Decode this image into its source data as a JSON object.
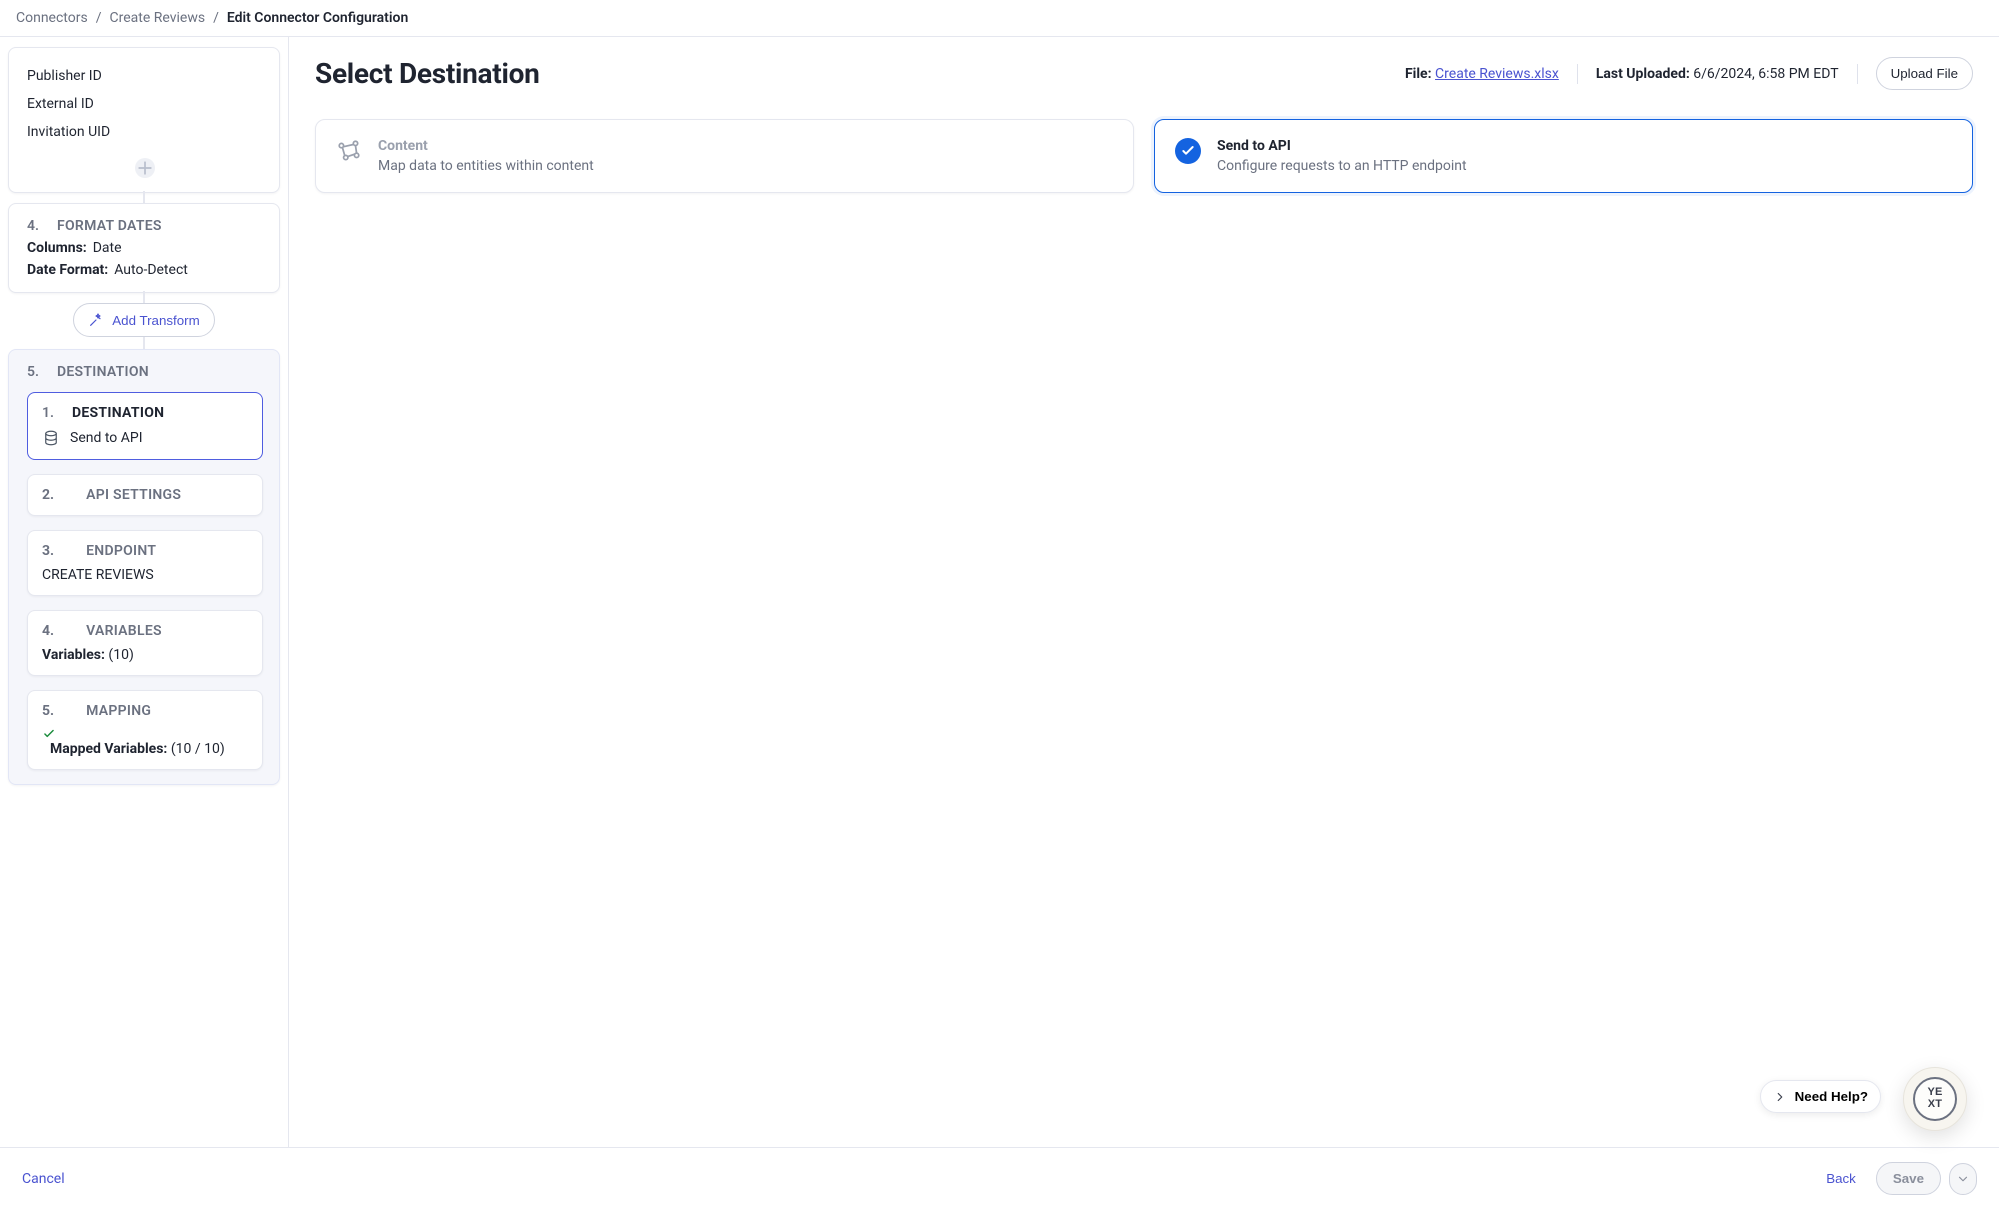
{
  "breadcrumb": {
    "root": "Connectors",
    "sep": "/",
    "mid": "Create Reviews",
    "current": "Edit Connector Configuration"
  },
  "sidebar": {
    "group_top": {
      "items": [
        "Publisher ID",
        "External ID",
        "Invitation UID"
      ]
    },
    "steps": {
      "format_dates": {
        "index": "4.",
        "title": "FORMAT DATES",
        "columns_label": "Columns:",
        "columns_value": "Date",
        "date_format_label": "Date Format:",
        "date_format_value": "Auto-Detect"
      },
      "add_transform_label": "Add Transform",
      "destination_group": {
        "index": "5.",
        "title": "DESTINATION",
        "items": {
          "destination": {
            "index": "1.",
            "title": "DESTINATION",
            "value": "Send to API"
          },
          "api_settings": {
            "index": "2.",
            "title": "API SETTINGS"
          },
          "endpoint": {
            "index": "3.",
            "title": "ENDPOINT",
            "value": "CREATE REVIEWS"
          },
          "variables": {
            "index": "4.",
            "title": "VARIABLES",
            "label": "Variables:",
            "value": "(10)"
          },
          "mapping": {
            "index": "5.",
            "title": "MAPPING",
            "label": "Mapped Variables:",
            "value": "(10 / 10)"
          }
        }
      }
    }
  },
  "main": {
    "title": "Select Destination",
    "file_label": "File:",
    "file_name": "Create Reviews.xlsx",
    "uploaded_label": "Last Uploaded:",
    "uploaded_value": "6/6/2024, 6:58 PM EDT",
    "upload_button": "Upload File",
    "options": {
      "content": {
        "title": "Content",
        "desc": "Map data to entities within content"
      },
      "send_api": {
        "title": "Send to API",
        "desc": "Configure requests to an HTTP endpoint"
      }
    }
  },
  "help": {
    "label": "Need Help?"
  },
  "footer": {
    "cancel": "Cancel",
    "back": "Back",
    "save": "Save"
  },
  "brand": {
    "yext_line1": "YE",
    "yext_line2": "XT"
  }
}
